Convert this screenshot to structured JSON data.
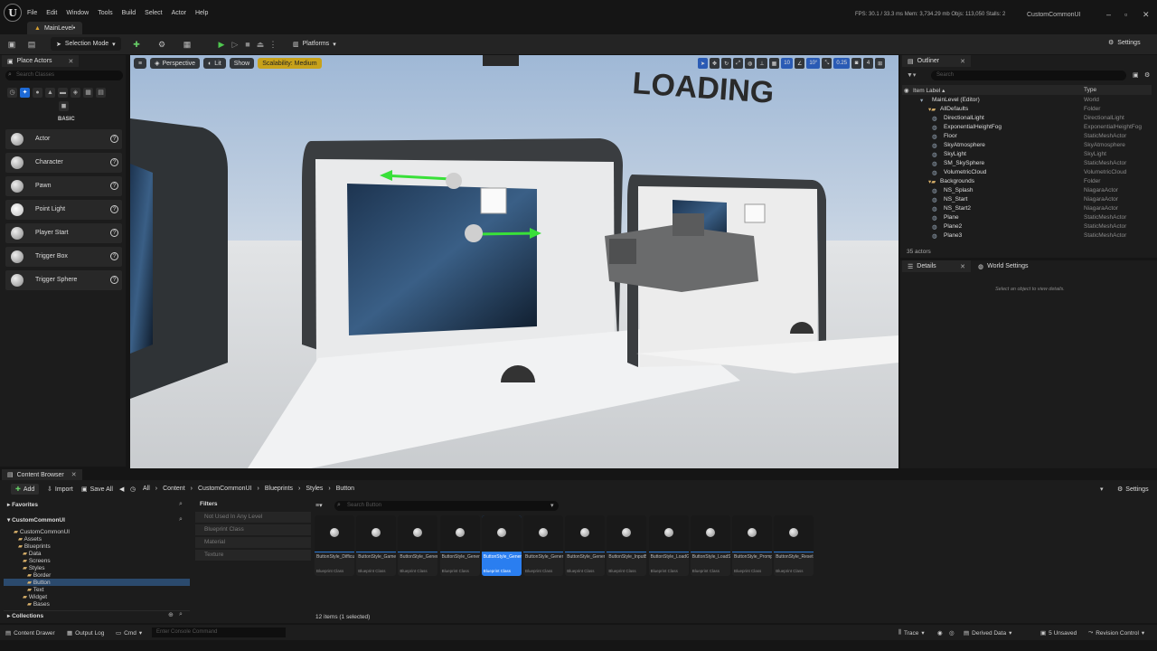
{
  "menu": {
    "items": [
      "File",
      "Edit",
      "Window",
      "Tools",
      "Build",
      "Select",
      "Actor",
      "Help"
    ],
    "stats": "FPS: 30.1  /  33.3 ms   Mem: 3,734.29 mb   Objs: 113,050   Stalls: 2",
    "project": "CustomCommonUI"
  },
  "level_tab": "MainLevel•",
  "toolbar": {
    "selection_mode": "Selection Mode",
    "platforms": "Platforms",
    "settings": "Settings"
  },
  "place_actors": {
    "title": "Place Actors",
    "search_placeholder": "Search Classes",
    "section": "BASIC",
    "items": [
      {
        "label": "Actor"
      },
      {
        "label": "Character"
      },
      {
        "label": "Pawn"
      },
      {
        "label": "Point Light"
      },
      {
        "label": "Player Start"
      },
      {
        "label": "Trigger Box"
      },
      {
        "label": "Trigger Sphere"
      }
    ]
  },
  "viewport": {
    "perspective": "Perspective",
    "lit": "Lit",
    "show": "Show",
    "scalability": "Scalability: Medium",
    "grid_snap": "10",
    "rot_snap": "10°",
    "scale_snap": "0.25",
    "cam_speed": "4",
    "sign_text": "LOADING"
  },
  "outliner": {
    "title": "Outliner",
    "search_placeholder": "Search",
    "col_label": "Item Label ▴",
    "col_type": "Type",
    "rows": [
      {
        "label": "MainLevel (Editor)",
        "type": "World"
      },
      {
        "label": "AllDefaults",
        "type": "Folder"
      },
      {
        "label": "DirectionalLight",
        "type": "DirectionalLight"
      },
      {
        "label": "ExponentialHeightFog",
        "type": "ExponentialHeightFog"
      },
      {
        "label": "Floor",
        "type": "StaticMeshActor"
      },
      {
        "label": "SkyAtmosphere",
        "type": "SkyAtmosphere"
      },
      {
        "label": "SkyLight",
        "type": "SkyLight"
      },
      {
        "label": "SM_SkySphere",
        "type": "StaticMeshActor"
      },
      {
        "label": "VolumetricCloud",
        "type": "VolumetricCloud"
      },
      {
        "label": "Backgrounds",
        "type": "Folder"
      },
      {
        "label": "NS_Splash",
        "type": "NiagaraActor"
      },
      {
        "label": "NS_Start",
        "type": "NiagaraActor"
      },
      {
        "label": "NS_Start2",
        "type": "NiagaraActor"
      },
      {
        "label": "Plane",
        "type": "StaticMeshActor"
      },
      {
        "label": "Plane2",
        "type": "StaticMeshActor"
      },
      {
        "label": "Plane3",
        "type": "StaticMeshActor"
      }
    ],
    "count": "35 actors"
  },
  "details": {
    "title": "Details",
    "world_settings": "World Settings",
    "empty": "Select an object to view details."
  },
  "content_browser": {
    "title": "Content Browser",
    "add": "Add",
    "import": "Import",
    "save_all": "Save All",
    "all": "All",
    "breadcrumb": [
      "Content",
      "CustomCommonUI",
      "Blueprints",
      "Styles",
      "Button"
    ],
    "settings": "Settings",
    "favorites": "Favorites",
    "root": "CustomCommonUI",
    "tree": [
      {
        "label": "CustomCommonUI",
        "depth": 1
      },
      {
        "label": "Assets",
        "depth": 2
      },
      {
        "label": "Blueprints",
        "depth": 2
      },
      {
        "label": "Data",
        "depth": 3
      },
      {
        "label": "Screens",
        "depth": 3
      },
      {
        "label": "Styles",
        "depth": 3
      },
      {
        "label": "Border",
        "depth": 4
      },
      {
        "label": "Button",
        "depth": 4
      },
      {
        "label": "Text",
        "depth": 4
      },
      {
        "label": "Widget",
        "depth": 3
      },
      {
        "label": "Bases",
        "depth": 4
      }
    ],
    "collections": "Collections",
    "filters_title": "Filters",
    "filters": [
      "Not Used In Any Level",
      "Blueprint Class",
      "Material",
      "Texture"
    ],
    "search_placeholder": "Search Button",
    "assets": [
      {
        "name": "ButtonStyle_DifficultyTab",
        "cls": "Blueprint Class"
      },
      {
        "name": "ButtonStyle_GameModeCard",
        "cls": "Blueprint Class"
      },
      {
        "name": "ButtonStyle_Generic",
        "cls": "Blueprint Class"
      },
      {
        "name": "ButtonStyle_Generic_Options",
        "cls": "Blueprint Class"
      },
      {
        "name": "ButtonStyle_Generic",
        "cls": "Blueprint Class"
      },
      {
        "name": "ButtonStyle_GenericEmpty",
        "cls": "Blueprint Class"
      },
      {
        "name": "ButtonStyle_GenericEmpty...",
        "cls": "Blueprint Class"
      },
      {
        "name": "ButtonStyle_InputBindButton",
        "cls": "Blueprint Class"
      },
      {
        "name": "ButtonStyle_LoadGameSlot",
        "cls": "Blueprint Class"
      },
      {
        "name": "ButtonStyle_LoadSlotModal",
        "cls": "Blueprint Class"
      },
      {
        "name": "ButtonStyle_PromptWindow",
        "cls": "Blueprint Class"
      },
      {
        "name": "ButtonStyle_Reset",
        "cls": "Blueprint Class"
      }
    ],
    "items_count": "12 items (1 selected)"
  },
  "status": {
    "content_drawer": "Content Drawer",
    "output_log": "Output Log",
    "cmd": "Cmd",
    "console_placeholder": "Enter Console Command",
    "trace": "Trace",
    "derived_data": "Derived Data",
    "unsaved": "5 Unsaved",
    "revision": "Revision Control"
  }
}
